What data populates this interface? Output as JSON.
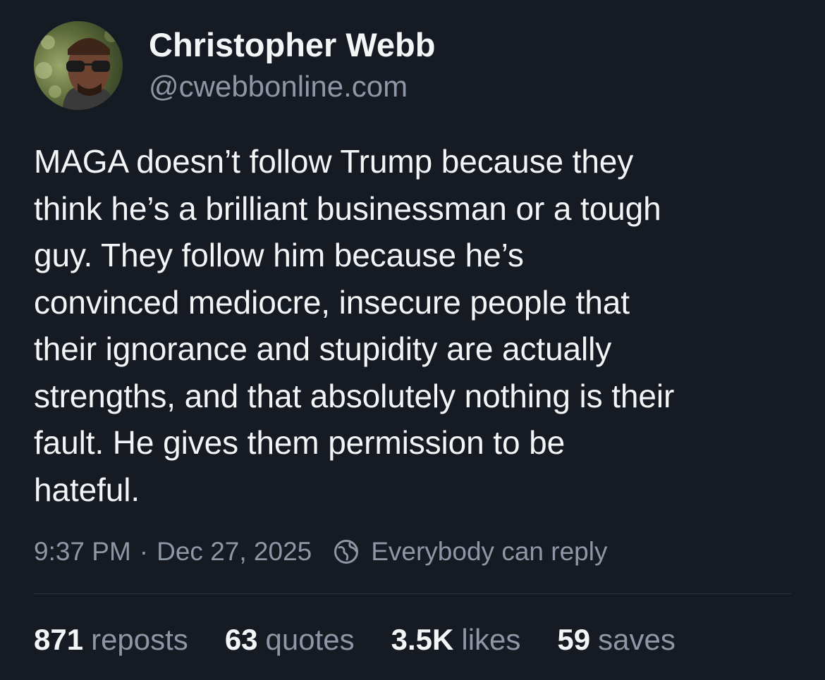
{
  "author": {
    "display_name": "Christopher Webb",
    "handle": "@cwebbonline.com",
    "avatar_icon": "profile-photo"
  },
  "post": {
    "text": "MAGA doesn’t follow Trump because they\nthink he’s a brilliant businessman or a tough\nguy. They follow him because he’s\nconvinced mediocre, insecure people that\ntheir ignorance and stupidity are actually\nstrengths, and that absolutely nothing is their\nfault. He gives them permission to be\nhateful."
  },
  "meta": {
    "time": "9:37 PM",
    "separator": "·",
    "date": "Dec 27, 2025",
    "reply_icon": "globe-icon",
    "reply_setting": "Everybody can reply"
  },
  "stats": {
    "reposts": {
      "count": "871",
      "label": "reposts"
    },
    "quotes": {
      "count": "63",
      "label": "quotes"
    },
    "likes": {
      "count": "3.5K",
      "label": "likes"
    },
    "saves": {
      "count": "59",
      "label": "saves"
    }
  },
  "colors": {
    "background": "#161a23",
    "primary_text": "#f3f4f6",
    "secondary_text": "#8e97a5",
    "divider": "#2b303b"
  }
}
